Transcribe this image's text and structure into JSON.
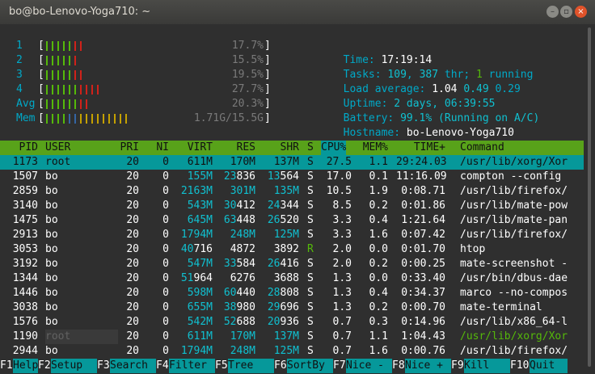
{
  "window": {
    "title": "bo@bo-Lenovo-Yoga710: ~"
  },
  "meters": [
    {
      "label": "1",
      "value": "17.7%",
      "green": 5,
      "red": 2,
      "blue": 0,
      "yellow": 0
    },
    {
      "label": "2",
      "value": "15.5%",
      "green": 5,
      "red": 1,
      "blue": 0,
      "yellow": 0
    },
    {
      "label": "3",
      "value": "19.5%",
      "green": 5,
      "red": 2,
      "blue": 0,
      "yellow": 0
    },
    {
      "label": "4",
      "value": "27.7%",
      "green": 6,
      "red": 4,
      "blue": 0,
      "yellow": 0
    },
    {
      "label": "Avg",
      "value": "20.3%",
      "green": 6,
      "red": 2,
      "blue": 0,
      "yellow": 0
    },
    {
      "label": "Mem",
      "value": "1.71G/15.5G",
      "green": 4,
      "red": 0,
      "blue": 2,
      "yellow": 9
    }
  ],
  "info": {
    "time_label": "Time:",
    "time": "17:19:14",
    "tasks_label": "Tasks:",
    "tasks": "109",
    "thr": "387",
    "thr_label": "thr;",
    "running": "1",
    "running_label": "running",
    "load_label": "Load average:",
    "load1": "1.04",
    "load5": "0.49",
    "load15": "0.29",
    "uptime_label": "Uptime:",
    "uptime": "2 days, 06:39:55",
    "battery_label": "Battery:",
    "battery": "99.1% (Running on A/C)",
    "hostname_label": "Hostname:",
    "hostname": "bo-Lenovo-Yoga710"
  },
  "columns": {
    "pid": "PID",
    "user": "USER",
    "pri": "PRI",
    "ni": "NI",
    "virt": "VIRT",
    "res": "RES",
    "shr": "SHR",
    "s": "S",
    "cpu": "CPU%",
    "mem": "MEM%",
    "time": "TIME+",
    "command": "Command"
  },
  "processes": [
    {
      "pid": "1173",
      "user": "root",
      "pri": "20",
      "ni": "0",
      "virt": "611M",
      "res": "170M",
      "shr": "137M",
      "s": "S",
      "cpu": "27.5",
      "mem": "1.1",
      "time": "29:24.03",
      "command": "/usr/lib/xorg/Xor"
    },
    {
      "pid": "1507",
      "user": "bo",
      "pri": "20",
      "ni": "0",
      "virt": "155M",
      "res": "23836",
      "shr": "13564",
      "s": "S",
      "cpu": "17.0",
      "mem": "0.1",
      "time": "11:16.09",
      "command": "compton --config"
    },
    {
      "pid": "2859",
      "user": "bo",
      "pri": "20",
      "ni": "0",
      "virt": "2163M",
      "res": "301M",
      "shr": "135M",
      "s": "S",
      "cpu": "10.5",
      "mem": "1.9",
      "time": "0:08.71",
      "command": "/usr/lib/firefox/"
    },
    {
      "pid": "3140",
      "user": "bo",
      "pri": "20",
      "ni": "0",
      "virt": "543M",
      "res": "30412",
      "shr": "24344",
      "s": "S",
      "cpu": "8.5",
      "mem": "0.2",
      "time": "0:01.86",
      "command": "/usr/lib/mate-pow"
    },
    {
      "pid": "1475",
      "user": "bo",
      "pri": "20",
      "ni": "0",
      "virt": "645M",
      "res": "63448",
      "shr": "26520",
      "s": "S",
      "cpu": "3.3",
      "mem": "0.4",
      "time": "1:21.64",
      "command": "/usr/lib/mate-pan"
    },
    {
      "pid": "2913",
      "user": "bo",
      "pri": "20",
      "ni": "0",
      "virt": "1794M",
      "res": "248M",
      "shr": "125M",
      "s": "S",
      "cpu": "3.3",
      "mem": "1.6",
      "time": "0:07.42",
      "command": "/usr/lib/firefox/"
    },
    {
      "pid": "3053",
      "user": "bo",
      "pri": "20",
      "ni": "0",
      "virt": "40716",
      "res": "4872",
      "shr": "3892",
      "s": "R",
      "cpu": "2.0",
      "mem": "0.0",
      "time": "0:01.70",
      "command": "htop"
    },
    {
      "pid": "3192",
      "user": "bo",
      "pri": "20",
      "ni": "0",
      "virt": "547M",
      "res": "33584",
      "shr": "26416",
      "s": "S",
      "cpu": "2.0",
      "mem": "0.2",
      "time": "0:00.25",
      "command": "mate-screenshot -"
    },
    {
      "pid": "1344",
      "user": "bo",
      "pri": "20",
      "ni": "0",
      "virt": "51964",
      "res": "6276",
      "shr": "3688",
      "s": "S",
      "cpu": "1.3",
      "mem": "0.0",
      "time": "0:33.40",
      "command": "/usr/bin/dbus-dae"
    },
    {
      "pid": "1446",
      "user": "bo",
      "pri": "20",
      "ni": "0",
      "virt": "598M",
      "res": "60440",
      "shr": "28808",
      "s": "S",
      "cpu": "1.3",
      "mem": "0.4",
      "time": "0:34.37",
      "command": "marco --no-compos"
    },
    {
      "pid": "3038",
      "user": "bo",
      "pri": "20",
      "ni": "0",
      "virt": "655M",
      "res": "38980",
      "shr": "29696",
      "s": "S",
      "cpu": "1.3",
      "mem": "0.2",
      "time": "0:00.70",
      "command": "mate-terminal"
    },
    {
      "pid": "1576",
      "user": "bo",
      "pri": "20",
      "ni": "0",
      "virt": "542M",
      "res": "52688",
      "shr": "20936",
      "s": "S",
      "cpu": "0.7",
      "mem": "0.3",
      "time": "0:14.96",
      "command": "/usr/lib/x86_64-l"
    },
    {
      "pid": "1190",
      "user": "root",
      "pri": "20",
      "ni": "0",
      "virt": "611M",
      "res": "170M",
      "shr": "137M",
      "s": "S",
      "cpu": "0.7",
      "mem": "1.1",
      "time": "1:04.43",
      "command": "/usr/lib/xorg/Xor"
    },
    {
      "pid": "2944",
      "user": "bo",
      "pri": "20",
      "ni": "0",
      "virt": "1794M",
      "res": "248M",
      "shr": "125M",
      "s": "S",
      "cpu": "0.7",
      "mem": "1.6",
      "time": "0:00.76",
      "command": "/usr/lib/firefox/"
    }
  ],
  "footer": [
    {
      "key": "F1",
      "label": "Help"
    },
    {
      "key": "F2",
      "label": "Setup"
    },
    {
      "key": "F3",
      "label": "Search"
    },
    {
      "key": "F4",
      "label": "Filter"
    },
    {
      "key": "F5",
      "label": "Tree"
    },
    {
      "key": "F6",
      "label": "SortBy"
    },
    {
      "key": "F7",
      "label": "Nice -"
    },
    {
      "key": "F8",
      "label": "Nice +"
    },
    {
      "key": "F9",
      "label": "Kill"
    },
    {
      "key": "F10",
      "label": "Quit"
    }
  ],
  "colors": {
    "header_bg": "#58a21a",
    "highlight_bg": "#06989a",
    "blue": "#00a9c8",
    "green": "#55b90a",
    "red": "#d0221a"
  }
}
